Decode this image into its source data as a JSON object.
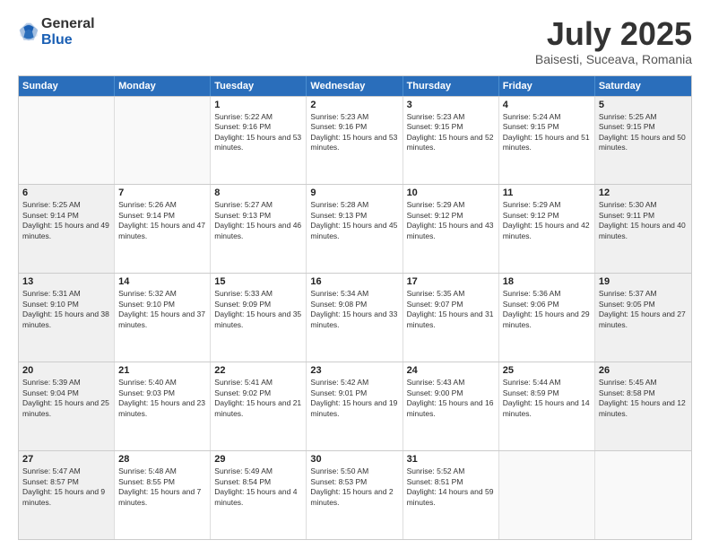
{
  "header": {
    "logo": {
      "general": "General",
      "blue": "Blue"
    },
    "title": "July 2025",
    "subtitle": "Baisesti, Suceava, Romania"
  },
  "calendar": {
    "days_of_week": [
      "Sunday",
      "Monday",
      "Tuesday",
      "Wednesday",
      "Thursday",
      "Friday",
      "Saturday"
    ],
    "weeks": [
      [
        {
          "day": "",
          "empty": true
        },
        {
          "day": "",
          "empty": true
        },
        {
          "day": "1",
          "sunrise": "Sunrise: 5:22 AM",
          "sunset": "Sunset: 9:16 PM",
          "daylight": "Daylight: 15 hours and 53 minutes."
        },
        {
          "day": "2",
          "sunrise": "Sunrise: 5:23 AM",
          "sunset": "Sunset: 9:16 PM",
          "daylight": "Daylight: 15 hours and 53 minutes."
        },
        {
          "day": "3",
          "sunrise": "Sunrise: 5:23 AM",
          "sunset": "Sunset: 9:15 PM",
          "daylight": "Daylight: 15 hours and 52 minutes."
        },
        {
          "day": "4",
          "sunrise": "Sunrise: 5:24 AM",
          "sunset": "Sunset: 9:15 PM",
          "daylight": "Daylight: 15 hours and 51 minutes."
        },
        {
          "day": "5",
          "sunrise": "Sunrise: 5:25 AM",
          "sunset": "Sunset: 9:15 PM",
          "daylight": "Daylight: 15 hours and 50 minutes."
        }
      ],
      [
        {
          "day": "6",
          "sunrise": "Sunrise: 5:25 AM",
          "sunset": "Sunset: 9:14 PM",
          "daylight": "Daylight: 15 hours and 49 minutes."
        },
        {
          "day": "7",
          "sunrise": "Sunrise: 5:26 AM",
          "sunset": "Sunset: 9:14 PM",
          "daylight": "Daylight: 15 hours and 47 minutes."
        },
        {
          "day": "8",
          "sunrise": "Sunrise: 5:27 AM",
          "sunset": "Sunset: 9:13 PM",
          "daylight": "Daylight: 15 hours and 46 minutes."
        },
        {
          "day": "9",
          "sunrise": "Sunrise: 5:28 AM",
          "sunset": "Sunset: 9:13 PM",
          "daylight": "Daylight: 15 hours and 45 minutes."
        },
        {
          "day": "10",
          "sunrise": "Sunrise: 5:29 AM",
          "sunset": "Sunset: 9:12 PM",
          "daylight": "Daylight: 15 hours and 43 minutes."
        },
        {
          "day": "11",
          "sunrise": "Sunrise: 5:29 AM",
          "sunset": "Sunset: 9:12 PM",
          "daylight": "Daylight: 15 hours and 42 minutes."
        },
        {
          "day": "12",
          "sunrise": "Sunrise: 5:30 AM",
          "sunset": "Sunset: 9:11 PM",
          "daylight": "Daylight: 15 hours and 40 minutes."
        }
      ],
      [
        {
          "day": "13",
          "sunrise": "Sunrise: 5:31 AM",
          "sunset": "Sunset: 9:10 PM",
          "daylight": "Daylight: 15 hours and 38 minutes."
        },
        {
          "day": "14",
          "sunrise": "Sunrise: 5:32 AM",
          "sunset": "Sunset: 9:10 PM",
          "daylight": "Daylight: 15 hours and 37 minutes."
        },
        {
          "day": "15",
          "sunrise": "Sunrise: 5:33 AM",
          "sunset": "Sunset: 9:09 PM",
          "daylight": "Daylight: 15 hours and 35 minutes."
        },
        {
          "day": "16",
          "sunrise": "Sunrise: 5:34 AM",
          "sunset": "Sunset: 9:08 PM",
          "daylight": "Daylight: 15 hours and 33 minutes."
        },
        {
          "day": "17",
          "sunrise": "Sunrise: 5:35 AM",
          "sunset": "Sunset: 9:07 PM",
          "daylight": "Daylight: 15 hours and 31 minutes."
        },
        {
          "day": "18",
          "sunrise": "Sunrise: 5:36 AM",
          "sunset": "Sunset: 9:06 PM",
          "daylight": "Daylight: 15 hours and 29 minutes."
        },
        {
          "day": "19",
          "sunrise": "Sunrise: 5:37 AM",
          "sunset": "Sunset: 9:05 PM",
          "daylight": "Daylight: 15 hours and 27 minutes."
        }
      ],
      [
        {
          "day": "20",
          "sunrise": "Sunrise: 5:39 AM",
          "sunset": "Sunset: 9:04 PM",
          "daylight": "Daylight: 15 hours and 25 minutes."
        },
        {
          "day": "21",
          "sunrise": "Sunrise: 5:40 AM",
          "sunset": "Sunset: 9:03 PM",
          "daylight": "Daylight: 15 hours and 23 minutes."
        },
        {
          "day": "22",
          "sunrise": "Sunrise: 5:41 AM",
          "sunset": "Sunset: 9:02 PM",
          "daylight": "Daylight: 15 hours and 21 minutes."
        },
        {
          "day": "23",
          "sunrise": "Sunrise: 5:42 AM",
          "sunset": "Sunset: 9:01 PM",
          "daylight": "Daylight: 15 hours and 19 minutes."
        },
        {
          "day": "24",
          "sunrise": "Sunrise: 5:43 AM",
          "sunset": "Sunset: 9:00 PM",
          "daylight": "Daylight: 15 hours and 16 minutes."
        },
        {
          "day": "25",
          "sunrise": "Sunrise: 5:44 AM",
          "sunset": "Sunset: 8:59 PM",
          "daylight": "Daylight: 15 hours and 14 minutes."
        },
        {
          "day": "26",
          "sunrise": "Sunrise: 5:45 AM",
          "sunset": "Sunset: 8:58 PM",
          "daylight": "Daylight: 15 hours and 12 minutes."
        }
      ],
      [
        {
          "day": "27",
          "sunrise": "Sunrise: 5:47 AM",
          "sunset": "Sunset: 8:57 PM",
          "daylight": "Daylight: 15 hours and 9 minutes."
        },
        {
          "day": "28",
          "sunrise": "Sunrise: 5:48 AM",
          "sunset": "Sunset: 8:55 PM",
          "daylight": "Daylight: 15 hours and 7 minutes."
        },
        {
          "day": "29",
          "sunrise": "Sunrise: 5:49 AM",
          "sunset": "Sunset: 8:54 PM",
          "daylight": "Daylight: 15 hours and 4 minutes."
        },
        {
          "day": "30",
          "sunrise": "Sunrise: 5:50 AM",
          "sunset": "Sunset: 8:53 PM",
          "daylight": "Daylight: 15 hours and 2 minutes."
        },
        {
          "day": "31",
          "sunrise": "Sunrise: 5:52 AM",
          "sunset": "Sunset: 8:51 PM",
          "daylight": "Daylight: 14 hours and 59 minutes."
        },
        {
          "day": "",
          "empty": true
        },
        {
          "day": "",
          "empty": true
        }
      ]
    ]
  }
}
